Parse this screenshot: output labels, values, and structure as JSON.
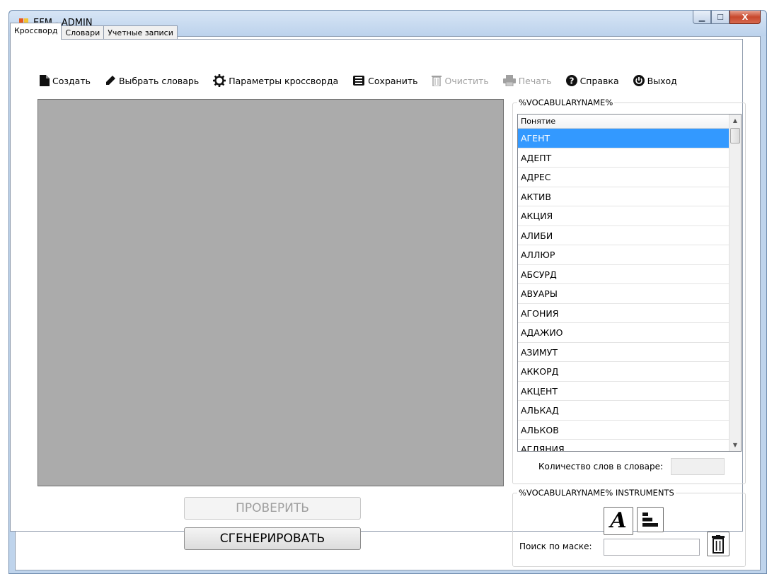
{
  "window": {
    "title": "EFM - ADMIN",
    "caption_buttons": {
      "minimize": "▁",
      "maximize": "☐",
      "close": "X"
    }
  },
  "tabs": [
    {
      "label": "Кроссворд"
    },
    {
      "label": "Словари"
    },
    {
      "label": "Учетные записи"
    }
  ],
  "toolbar": {
    "create": "Создать",
    "select_dictionary": "Выбрать словарь",
    "crossword_params": "Параметры кроссворда",
    "save": "Сохранить",
    "clear": "Очистить",
    "print": "Печать",
    "help": "Справка",
    "exit": "Выход"
  },
  "buttons": {
    "check": "ПРОВЕРИТЬ",
    "generate": "СГЕНЕРИРОВАТЬ"
  },
  "vocabulary": {
    "group_title": "%VOCABULARYNAME%",
    "column_header": "Понятие",
    "words": [
      "АГЕНТ",
      "АДЕПТ",
      "АДРЕС",
      "АКТИВ",
      "АКЦИЯ",
      "АЛИБИ",
      "АЛЛЮР",
      "АБСУРД",
      "АВУАРЫ",
      "АГОНИЯ",
      "АДАЖИО",
      "АЗИМУТ",
      "АККОРД",
      "АКЦЕНТ",
      "АЛЬКАД",
      "АЛЬКОВ",
      "АГЛЯНИЯ"
    ],
    "selected_index": 0,
    "count_label": "Количество слов в словаре:"
  },
  "instruments": {
    "group_title": "%VOCABULARYNAME% INSTRUMENTS",
    "font_glyph": "A",
    "mask_label": "Поиск по маске:"
  }
}
